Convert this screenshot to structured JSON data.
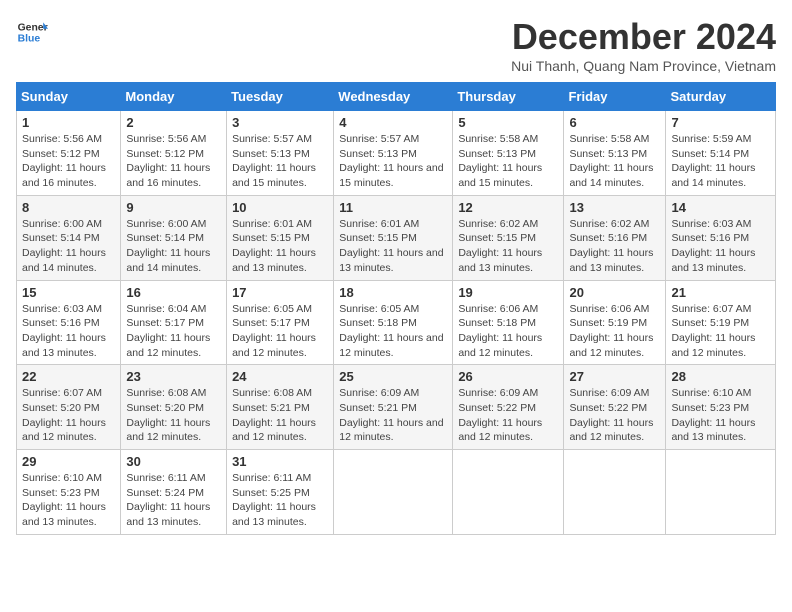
{
  "logo": {
    "general": "General",
    "blue": "Blue"
  },
  "title": {
    "month_year": "December 2024",
    "location": "Nui Thanh, Quang Nam Province, Vietnam"
  },
  "columns": [
    "Sunday",
    "Monday",
    "Tuesday",
    "Wednesday",
    "Thursday",
    "Friday",
    "Saturday"
  ],
  "weeks": [
    [
      {
        "day": "1",
        "sunrise": "5:56 AM",
        "sunset": "5:12 PM",
        "daylight": "11 hours and 16 minutes."
      },
      {
        "day": "2",
        "sunrise": "5:56 AM",
        "sunset": "5:12 PM",
        "daylight": "11 hours and 16 minutes."
      },
      {
        "day": "3",
        "sunrise": "5:57 AM",
        "sunset": "5:13 PM",
        "daylight": "11 hours and 15 minutes."
      },
      {
        "day": "4",
        "sunrise": "5:57 AM",
        "sunset": "5:13 PM",
        "daylight": "11 hours and 15 minutes."
      },
      {
        "day": "5",
        "sunrise": "5:58 AM",
        "sunset": "5:13 PM",
        "daylight": "11 hours and 15 minutes."
      },
      {
        "day": "6",
        "sunrise": "5:58 AM",
        "sunset": "5:13 PM",
        "daylight": "11 hours and 14 minutes."
      },
      {
        "day": "7",
        "sunrise": "5:59 AM",
        "sunset": "5:14 PM",
        "daylight": "11 hours and 14 minutes."
      }
    ],
    [
      {
        "day": "8",
        "sunrise": "6:00 AM",
        "sunset": "5:14 PM",
        "daylight": "11 hours and 14 minutes."
      },
      {
        "day": "9",
        "sunrise": "6:00 AM",
        "sunset": "5:14 PM",
        "daylight": "11 hours and 14 minutes."
      },
      {
        "day": "10",
        "sunrise": "6:01 AM",
        "sunset": "5:15 PM",
        "daylight": "11 hours and 13 minutes."
      },
      {
        "day": "11",
        "sunrise": "6:01 AM",
        "sunset": "5:15 PM",
        "daylight": "11 hours and 13 minutes."
      },
      {
        "day": "12",
        "sunrise": "6:02 AM",
        "sunset": "5:15 PM",
        "daylight": "11 hours and 13 minutes."
      },
      {
        "day": "13",
        "sunrise": "6:02 AM",
        "sunset": "5:16 PM",
        "daylight": "11 hours and 13 minutes."
      },
      {
        "day": "14",
        "sunrise": "6:03 AM",
        "sunset": "5:16 PM",
        "daylight": "11 hours and 13 minutes."
      }
    ],
    [
      {
        "day": "15",
        "sunrise": "6:03 AM",
        "sunset": "5:16 PM",
        "daylight": "11 hours and 13 minutes."
      },
      {
        "day": "16",
        "sunrise": "6:04 AM",
        "sunset": "5:17 PM",
        "daylight": "11 hours and 12 minutes."
      },
      {
        "day": "17",
        "sunrise": "6:05 AM",
        "sunset": "5:17 PM",
        "daylight": "11 hours and 12 minutes."
      },
      {
        "day": "18",
        "sunrise": "6:05 AM",
        "sunset": "5:18 PM",
        "daylight": "11 hours and 12 minutes."
      },
      {
        "day": "19",
        "sunrise": "6:06 AM",
        "sunset": "5:18 PM",
        "daylight": "11 hours and 12 minutes."
      },
      {
        "day": "20",
        "sunrise": "6:06 AM",
        "sunset": "5:19 PM",
        "daylight": "11 hours and 12 minutes."
      },
      {
        "day": "21",
        "sunrise": "6:07 AM",
        "sunset": "5:19 PM",
        "daylight": "11 hours and 12 minutes."
      }
    ],
    [
      {
        "day": "22",
        "sunrise": "6:07 AM",
        "sunset": "5:20 PM",
        "daylight": "11 hours and 12 minutes."
      },
      {
        "day": "23",
        "sunrise": "6:08 AM",
        "sunset": "5:20 PM",
        "daylight": "11 hours and 12 minutes."
      },
      {
        "day": "24",
        "sunrise": "6:08 AM",
        "sunset": "5:21 PM",
        "daylight": "11 hours and 12 minutes."
      },
      {
        "day": "25",
        "sunrise": "6:09 AM",
        "sunset": "5:21 PM",
        "daylight": "11 hours and 12 minutes."
      },
      {
        "day": "26",
        "sunrise": "6:09 AM",
        "sunset": "5:22 PM",
        "daylight": "11 hours and 12 minutes."
      },
      {
        "day": "27",
        "sunrise": "6:09 AM",
        "sunset": "5:22 PM",
        "daylight": "11 hours and 12 minutes."
      },
      {
        "day": "28",
        "sunrise": "6:10 AM",
        "sunset": "5:23 PM",
        "daylight": "11 hours and 13 minutes."
      }
    ],
    [
      {
        "day": "29",
        "sunrise": "6:10 AM",
        "sunset": "5:23 PM",
        "daylight": "11 hours and 13 minutes."
      },
      {
        "day": "30",
        "sunrise": "6:11 AM",
        "sunset": "5:24 PM",
        "daylight": "11 hours and 13 minutes."
      },
      {
        "day": "31",
        "sunrise": "6:11 AM",
        "sunset": "5:25 PM",
        "daylight": "11 hours and 13 minutes."
      },
      null,
      null,
      null,
      null
    ]
  ]
}
